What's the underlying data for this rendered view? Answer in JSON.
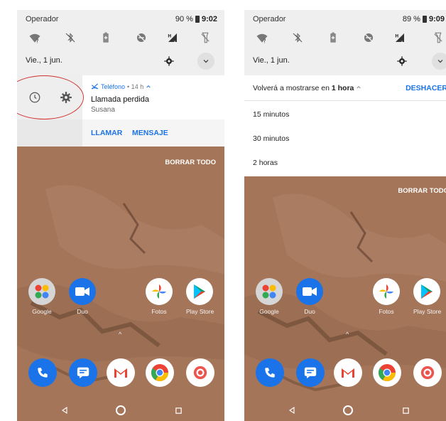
{
  "left": {
    "status": {
      "carrier": "Operador",
      "battery": "90 %",
      "time": "9:02"
    },
    "date": "Vie., 1 jun.",
    "notification": {
      "app": "Teléfono",
      "meta": "• 14 h",
      "title": "Llamada perdida",
      "subtitle": "Susana",
      "actions": [
        "LLAMAR",
        "MENSAJE"
      ]
    },
    "clear_all": "BORRAR TODO"
  },
  "right": {
    "status": {
      "carrier": "Operador",
      "battery": "89 %",
      "time": "9:09"
    },
    "date": "Vie., 1 jun.",
    "snooze": {
      "message_prefix": "Volverá a mostrarse en",
      "message_value": "1 hora",
      "undo": "DESHACER",
      "options": [
        "15 minutos",
        "30 minutos",
        "2 horas"
      ]
    },
    "clear_all": "BORRAR TODO"
  },
  "apps": [
    {
      "name": "Google",
      "icon": "google-folder-icon",
      "color": "#e0e0e0"
    },
    {
      "name": "Duo",
      "icon": "duo-icon",
      "color": "#1a73e8"
    },
    {
      "name": "Fotos",
      "icon": "photos-icon",
      "color": "#ffffff"
    },
    {
      "name": "Play Store",
      "icon": "play-store-icon",
      "color": "#ffffff"
    }
  ],
  "dock": [
    {
      "icon": "phone-icon",
      "color": "#1a73e8"
    },
    {
      "icon": "messages-icon",
      "color": "#1a73e8"
    },
    {
      "icon": "gmail-icon",
      "color": "#ffffff"
    },
    {
      "icon": "chrome-icon",
      "color": "#ffffff"
    },
    {
      "icon": "camera-icon",
      "color": "#ffffff"
    }
  ],
  "colors": {
    "accent": "#1a73e8",
    "highlight": "#d32f2f",
    "wallpaper": "#a47559"
  }
}
